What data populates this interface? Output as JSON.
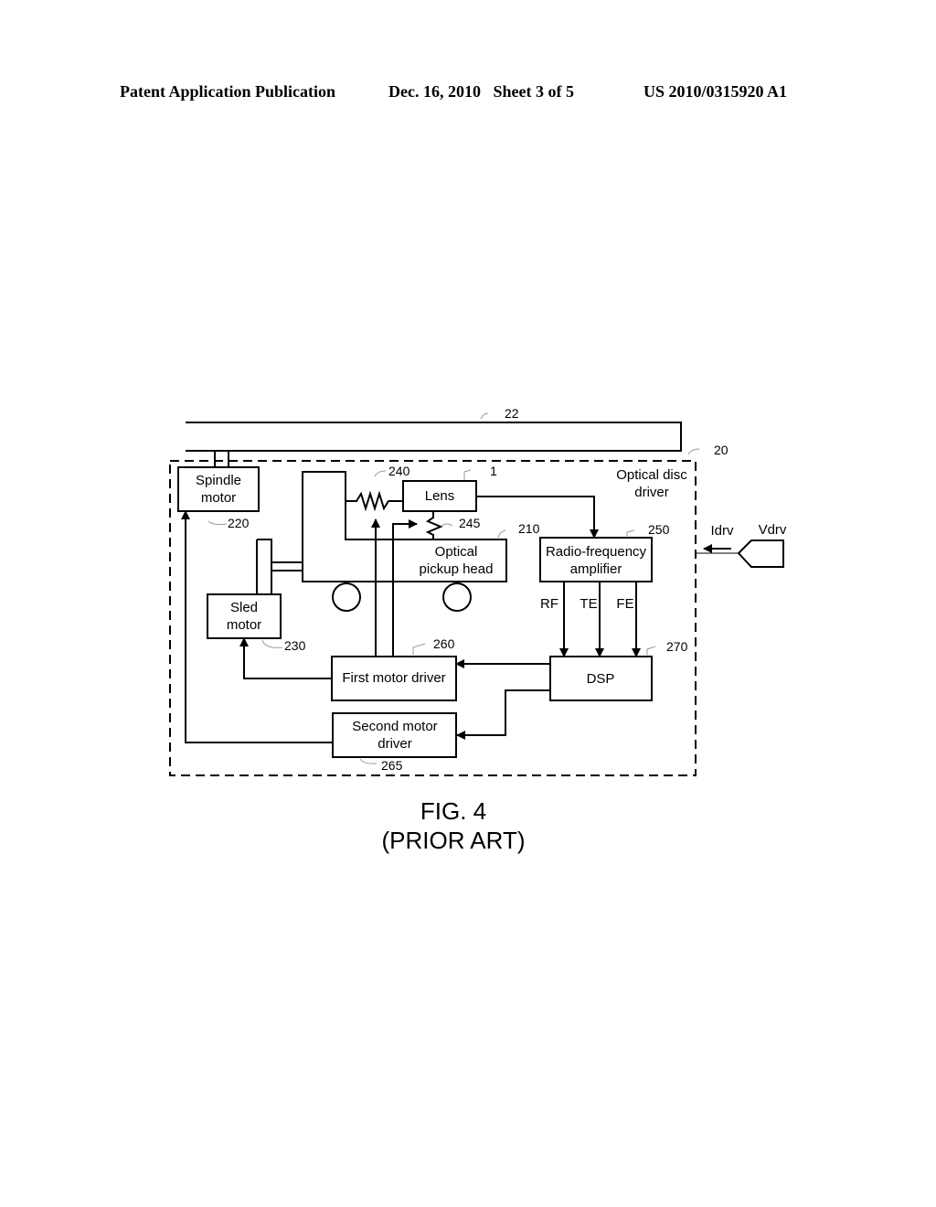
{
  "header": {
    "publication": "Patent Application Publication",
    "date_sheet": "Dec. 16, 2010   Sheet 3 of 5",
    "number": "US 2010/0315920 A1"
  },
  "diagram": {
    "disc_ref": "22",
    "driver_ref": "20",
    "driver_label": [
      "Optical disc",
      "driver"
    ],
    "spindle": {
      "label": [
        "Spindle",
        "motor"
      ],
      "ref": "220"
    },
    "sled": {
      "label": [
        "Sled",
        "motor"
      ],
      "ref": "230"
    },
    "spring_ref": "240",
    "lens": {
      "label": "Lens",
      "ref": "1"
    },
    "spring2_ref": "245",
    "pickup": {
      "label": [
        "Optical",
        "pickup head"
      ],
      "ref": "210"
    },
    "rf_amp": {
      "label": [
        "Radio-frequency",
        "amplifier"
      ],
      "ref": "250"
    },
    "signals": [
      "RF",
      "TE",
      "FE"
    ],
    "dsp": {
      "label": "DSP",
      "ref": "270"
    },
    "first_driver": {
      "label": "First motor driver",
      "ref": "260"
    },
    "second_driver": {
      "label": [
        "Second motor",
        "driver"
      ],
      "ref": "265"
    },
    "idrv": "Idrv",
    "vdrv": "Vdrv"
  },
  "caption": {
    "figure": "FIG. 4",
    "note": "(PRIOR ART)"
  }
}
